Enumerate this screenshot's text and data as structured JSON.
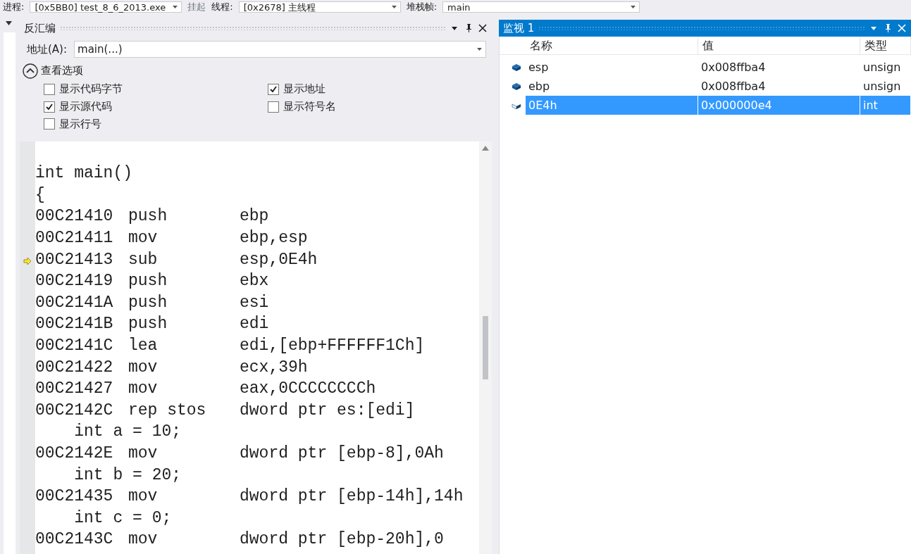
{
  "toolbar": {
    "process_label": "进程:",
    "process_value": "[0x5BB0] test_8_6_2013.exe",
    "suspend_button": "挂起",
    "thread_label": "线程:",
    "thread_value": "[0x2678] 主线程",
    "stack_frame_label": "堆栈帧:",
    "stack_frame_value": "main"
  },
  "disassembly": {
    "title": "反汇编",
    "address_label": "地址(A):",
    "address_value": "main(...)",
    "options_title": "查看选项",
    "options_expanded": true,
    "options": [
      {
        "label": "显示代码字节",
        "checked": false
      },
      {
        "label": "显示地址",
        "checked": true
      },
      {
        "label": "显示源代码",
        "checked": true
      },
      {
        "label": "显示符号名",
        "checked": false
      },
      {
        "label": "显示行号",
        "checked": false
      }
    ],
    "lines": [
      {
        "kind": "source",
        "text": "int main()"
      },
      {
        "kind": "source",
        "text": "{"
      },
      {
        "kind": "asm",
        "address": "00C21410",
        "mnemonic": "push",
        "operands": "ebp",
        "current": false
      },
      {
        "kind": "asm",
        "address": "00C21411",
        "mnemonic": "mov",
        "operands": "ebp,esp",
        "current": false
      },
      {
        "kind": "asm",
        "address": "00C21413",
        "mnemonic": "sub",
        "operands": "esp,0E4h",
        "current": true
      },
      {
        "kind": "asm",
        "address": "00C21419",
        "mnemonic": "push",
        "operands": "ebx",
        "current": false
      },
      {
        "kind": "asm",
        "address": "00C2141A",
        "mnemonic": "push",
        "operands": "esi",
        "current": false
      },
      {
        "kind": "asm",
        "address": "00C2141B",
        "mnemonic": "push",
        "operands": "edi",
        "current": false
      },
      {
        "kind": "asm",
        "address": "00C2141C",
        "mnemonic": "lea",
        "operands": "edi,[ebp+FFFFFF1Ch]",
        "current": false
      },
      {
        "kind": "asm",
        "address": "00C21422",
        "mnemonic": "mov",
        "operands": "ecx,39h",
        "current": false
      },
      {
        "kind": "asm",
        "address": "00C21427",
        "mnemonic": "mov",
        "operands": "eax,0CCCCCCCCh",
        "current": false
      },
      {
        "kind": "asm",
        "address": "00C2142C",
        "mnemonic": "rep stos",
        "operands": "dword ptr es:[edi]",
        "current": false
      },
      {
        "kind": "source",
        "text": "    int a = 10;"
      },
      {
        "kind": "asm",
        "address": "00C2142E",
        "mnemonic": "mov",
        "operands": "dword ptr [ebp-8],0Ah",
        "current": false
      },
      {
        "kind": "source",
        "text": "    int b = 20;"
      },
      {
        "kind": "asm",
        "address": "00C21435",
        "mnemonic": "mov",
        "operands": "dword ptr [ebp-14h],14h",
        "current": false
      },
      {
        "kind": "source",
        "text": "    int c = 0;"
      },
      {
        "kind": "asm",
        "address": "00C2143C",
        "mnemonic": "mov",
        "operands": "dword ptr [ebp-20h],0",
        "current": false
      }
    ]
  },
  "watch": {
    "title": "监视 1",
    "columns": [
      "名称",
      "值",
      "类型"
    ],
    "rows": [
      {
        "name": "esp",
        "value": "0x008ffba4",
        "type": "unsign",
        "selected": false
      },
      {
        "name": "ebp",
        "value": "0x008ffba4",
        "type": "unsign",
        "selected": false
      },
      {
        "name": "0E4h",
        "value": "0x000000e4",
        "type": "int",
        "selected": true
      }
    ]
  }
}
